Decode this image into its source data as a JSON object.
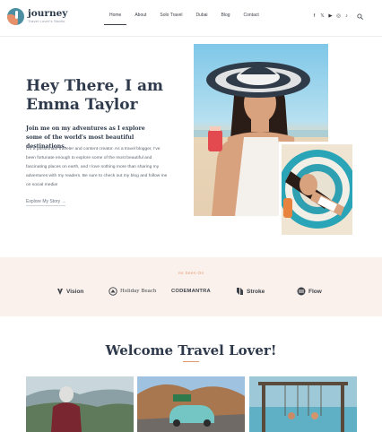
{
  "brand": {
    "name": "journey",
    "tagline": "Travel Lover's Studio",
    "colors": {
      "accent": "#e09a70",
      "heading": "#2e3a4b",
      "featured_bg": "#fbf1ec"
    }
  },
  "nav": {
    "items": [
      {
        "label": "Home",
        "active": true
      },
      {
        "label": "About",
        "active": false
      },
      {
        "label": "Solo Travel",
        "active": false
      },
      {
        "label": "Dubai",
        "active": false
      },
      {
        "label": "Blog",
        "active": false
      },
      {
        "label": "Contact",
        "active": false
      }
    ]
  },
  "social": {
    "icons": [
      {
        "name": "facebook-icon",
        "glyph": "f"
      },
      {
        "name": "twitter-icon",
        "glyph": "𝕏"
      },
      {
        "name": "youtube-icon",
        "glyph": "▶"
      },
      {
        "name": "instagram-icon",
        "glyph": "◎"
      },
      {
        "name": "tiktok-icon",
        "glyph": "♪"
      }
    ],
    "search_icon": "search-icon"
  },
  "hero": {
    "title": "Hey There, I am Emma Taylor",
    "subtitle": "Join me on my adventures as I explore some of the world's most beautiful destinations.",
    "body": "I'm a passionate traveler and content creator. As a travel blogger, I've been fortunate enough to explore some of the most beautiful and fascinating places on earth, and I love nothing more than sharing my adventures with my readers. Be sure to check out my blog and follow me on social media!",
    "link_label": "Explore My Story →"
  },
  "featured": {
    "label": "As Seen On",
    "brands": [
      {
        "name": "Vision",
        "icon": "vision-logo-icon"
      },
      {
        "name": "Holiday Beach",
        "icon": "holiday-beach-logo-icon"
      },
      {
        "name": "CODEMANTRA",
        "icon": ""
      },
      {
        "name": "Stroke",
        "icon": "stroke-logo-icon"
      },
      {
        "name": "Flow",
        "icon": "flow-logo-icon"
      }
    ]
  },
  "welcome": {
    "title": "Welcome Travel Lover!"
  }
}
